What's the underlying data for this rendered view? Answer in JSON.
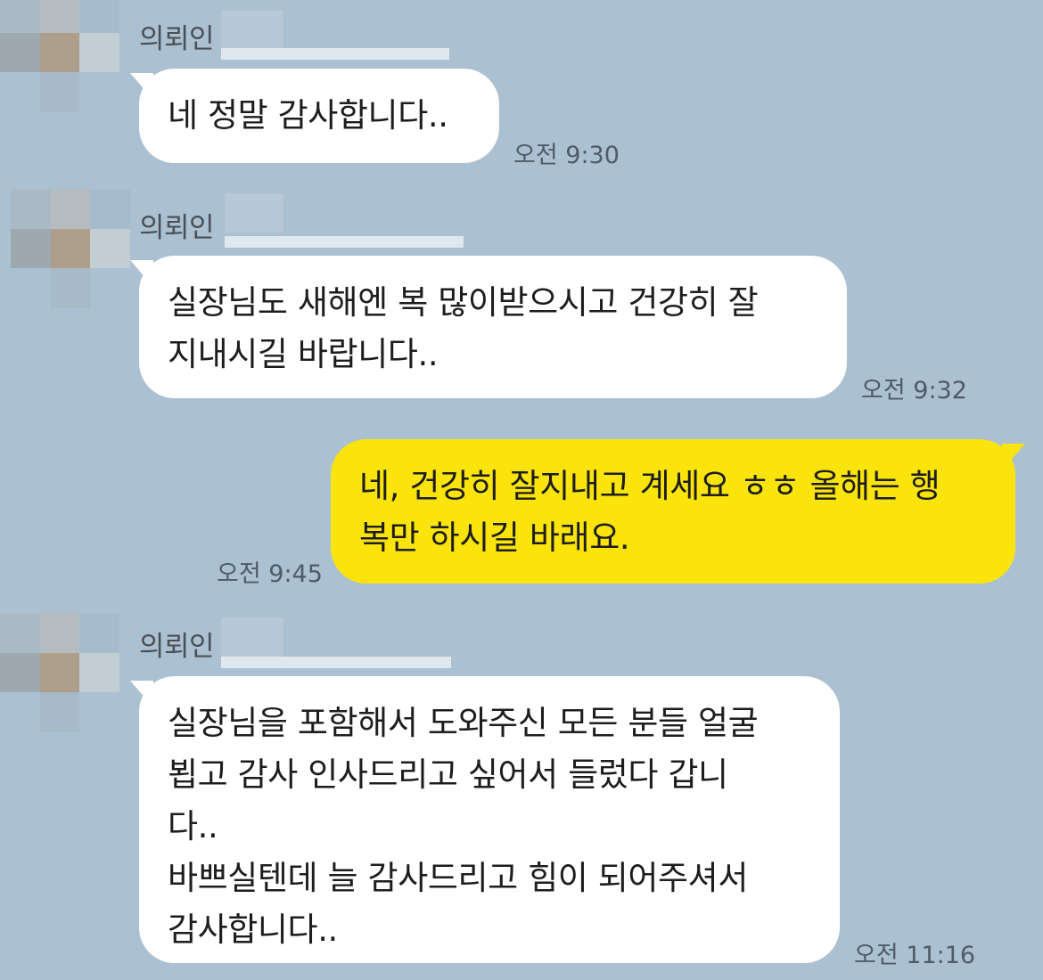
{
  "chat": {
    "messages": [
      {
        "sender": "의뢰인",
        "direction": "incoming",
        "text": "네 정말 감사합니다..",
        "time": "오전 9:30"
      },
      {
        "sender": "의뢰인",
        "direction": "incoming",
        "text": "실장님도 새해엔 복 많이받으시고 건강히 잘\n지내시길 바랍니다..",
        "time": "오전 9:32"
      },
      {
        "direction": "outgoing",
        "text": "네, 건강히 잘지내고 계세요 ㅎㅎ 올해는 행\n복만 하시길 바래요.",
        "time": "오전 9:45"
      },
      {
        "sender": "의뢰인",
        "direction": "incoming",
        "text": "실장님을 포함해서 도와주신 모든 분들 얼굴\n뵙고 감사 인사드리고 싶어서 들렀다 갑니\n다..\n바쁘실텐데 늘 감사드리고 힘이 되어주셔서\n감사합니다..",
        "time": "오전 11:16"
      }
    ]
  },
  "colors": {
    "background": "#abc1d1",
    "incoming_bubble": "#ffffff",
    "outgoing_bubble": "#fae40b",
    "time_text": "#4f5b66"
  }
}
